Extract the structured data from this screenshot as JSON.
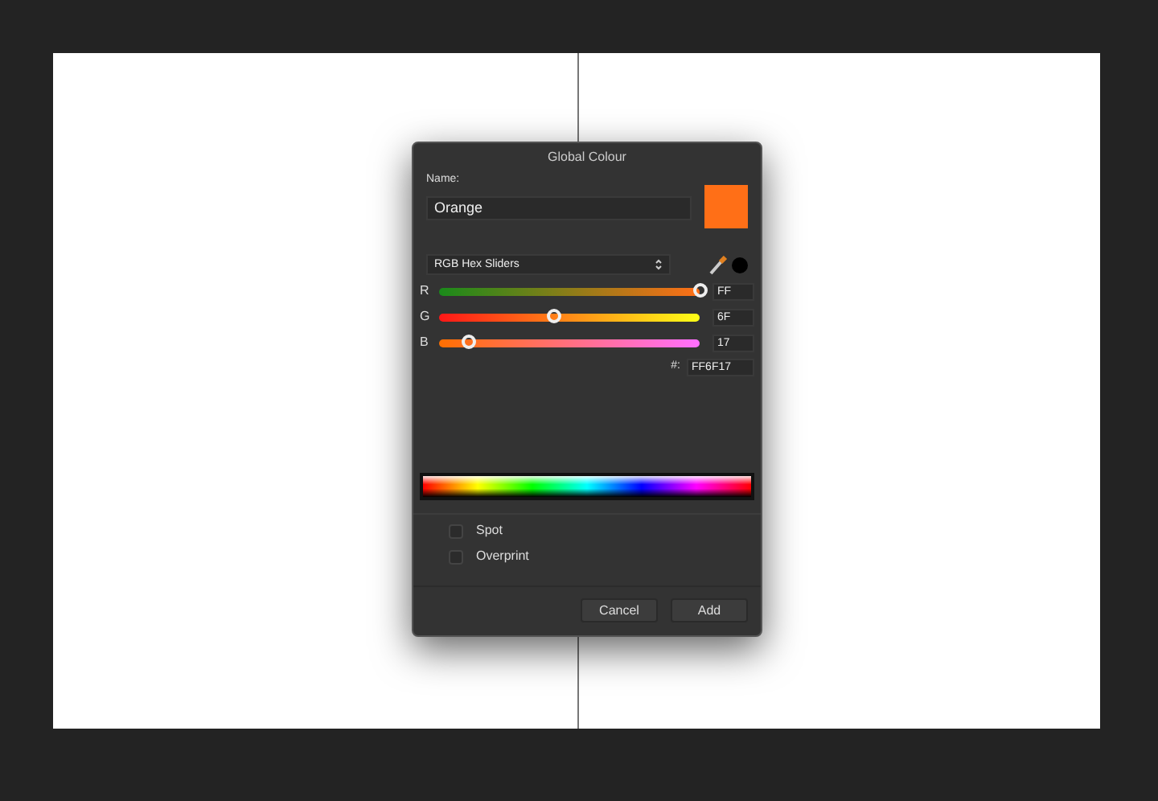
{
  "dialog": {
    "title": "Global Colour",
    "name_label": "Name:",
    "name_value": "Orange",
    "swatch": {
      "color": "#ff6f17"
    },
    "model": "RGB Hex Sliders",
    "sliders": [
      {
        "label": "R",
        "level": 1.0,
        "value": "FF"
      },
      {
        "label": "G",
        "level": 0.44,
        "value": "6F"
      },
      {
        "label": "B",
        "level": 0.11,
        "value": "17"
      }
    ],
    "hex_label": "#:",
    "hex_value": "FF6F17",
    "options": [
      {
        "label": "Spot",
        "checked": false
      },
      {
        "label": "Overprint",
        "checked": false
      }
    ],
    "buttons": [
      "Cancel",
      "Add"
    ]
  }
}
